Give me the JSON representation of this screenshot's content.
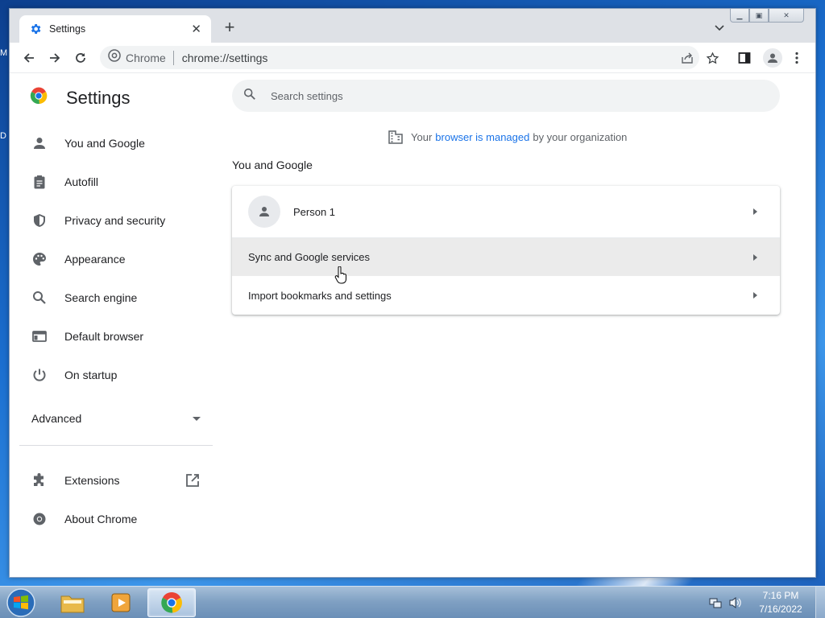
{
  "desktop": {
    "edge_letters": [
      "M",
      "D"
    ]
  },
  "browser": {
    "tab": {
      "title": "Settings",
      "favicon": "gear-icon"
    },
    "omnibox": {
      "site": "Chrome",
      "url": "chrome://settings"
    }
  },
  "settings": {
    "title": "Settings",
    "search_placeholder": "Search settings",
    "managed": {
      "prefix": "Your",
      "link": "browser is managed",
      "suffix": "by your organization"
    },
    "nav": [
      {
        "label": "You and Google",
        "icon": "person-icon"
      },
      {
        "label": "Autofill",
        "icon": "clipboard-icon"
      },
      {
        "label": "Privacy and security",
        "icon": "shield-icon"
      },
      {
        "label": "Appearance",
        "icon": "palette-icon"
      },
      {
        "label": "Search engine",
        "icon": "search-icon"
      },
      {
        "label": "Default browser",
        "icon": "browser-window-icon"
      },
      {
        "label": "On startup",
        "icon": "power-icon"
      }
    ],
    "advanced": "Advanced",
    "extensions": "Extensions",
    "about": "About Chrome",
    "section_title": "You and Google",
    "rows": {
      "person": "Person 1",
      "sync": "Sync and Google services",
      "import": "Import bookmarks and settings"
    }
  },
  "taskbar": {
    "clock_time": "7:16 PM",
    "clock_date": "7/16/2022"
  },
  "colors": {
    "accent": "#1a73e8",
    "text": "#202124",
    "muted": "#5f6368"
  }
}
